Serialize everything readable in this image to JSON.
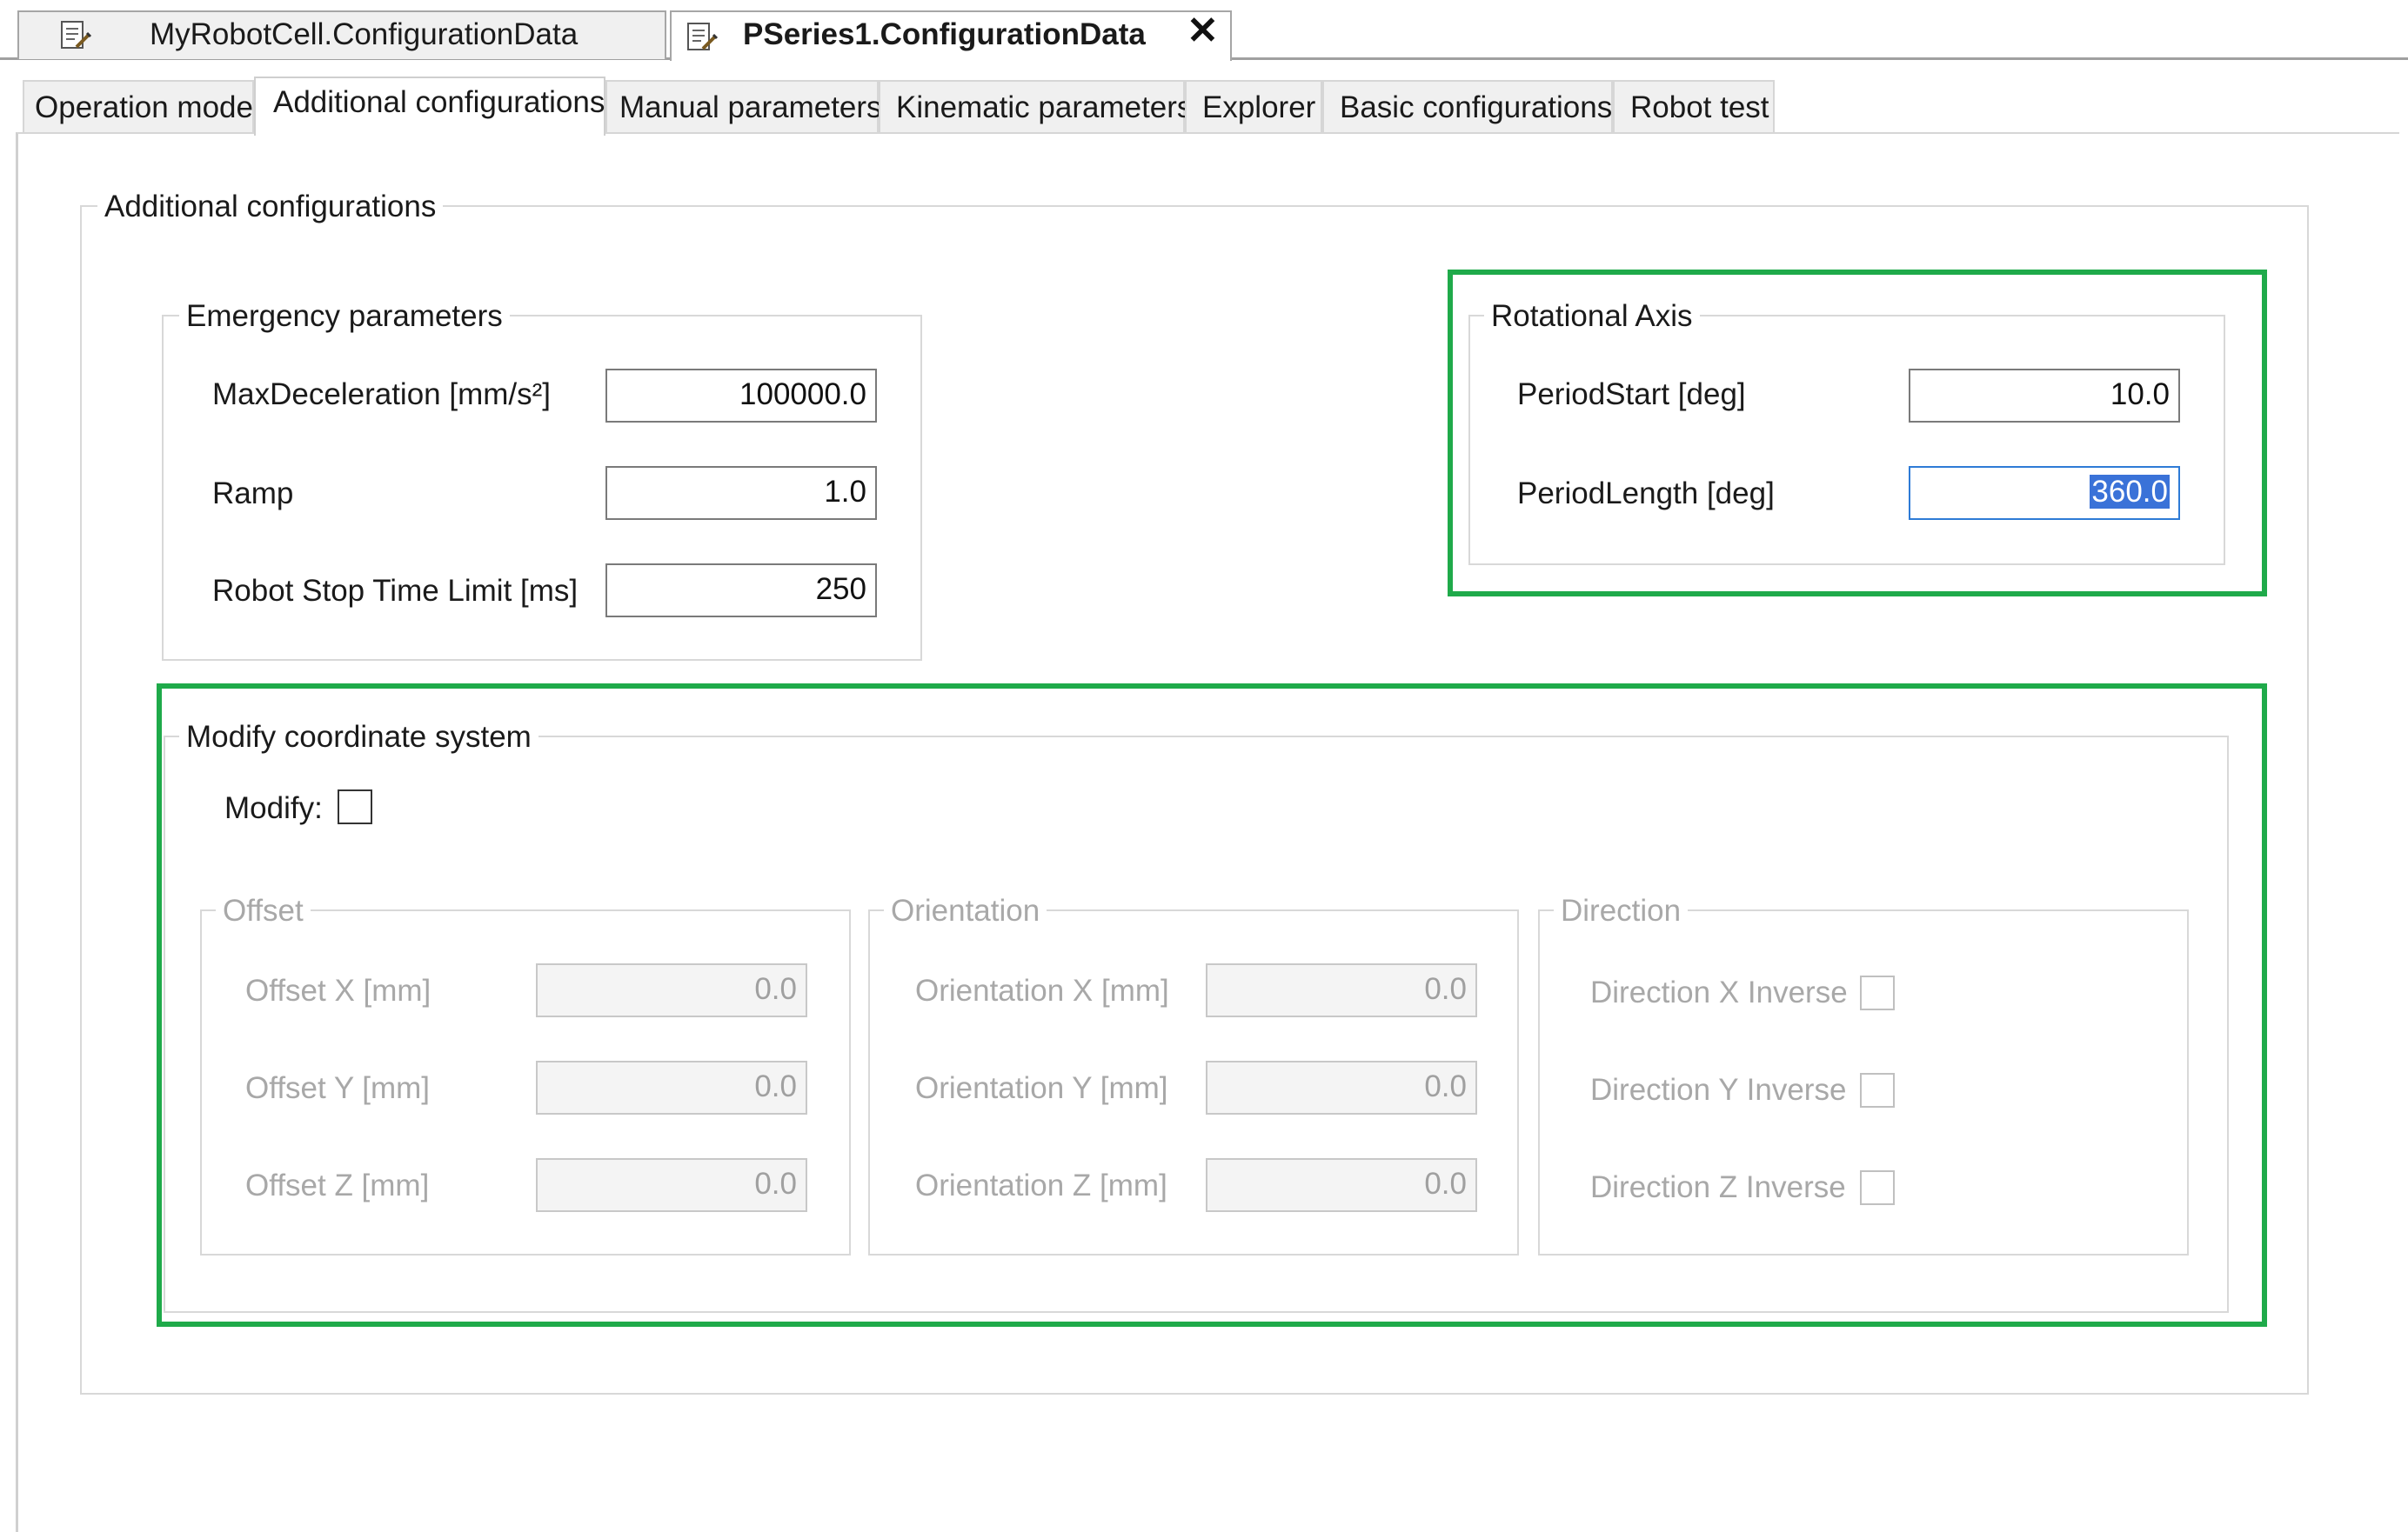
{
  "doc_tabs": [
    {
      "label": "MyRobotCell.ConfigurationData",
      "active": false
    },
    {
      "label": "PSeries1.ConfigurationData",
      "active": true,
      "close_glyph": "✕"
    }
  ],
  "tabs": [
    {
      "label": "Operation mode"
    },
    {
      "label": "Additional configurations"
    },
    {
      "label": "Manual parameters"
    },
    {
      "label": "Kinematic parameters"
    },
    {
      "label": "Explorer"
    },
    {
      "label": "Basic configurations"
    },
    {
      "label": "Robot test"
    }
  ],
  "main_group": {
    "title": "Additional configurations"
  },
  "emergency": {
    "title": "Emergency parameters",
    "fields": [
      {
        "label": "MaxDeceleration [mm/s²]",
        "value": "100000.0"
      },
      {
        "label": "Ramp",
        "value": "1.0"
      },
      {
        "label": "Robot Stop Time Limit [ms]",
        "value": "250"
      }
    ]
  },
  "rotational": {
    "title": "Rotational Axis",
    "fields": [
      {
        "label": "PeriodStart [deg]",
        "value": "10.0"
      },
      {
        "label": "PeriodLength [deg]",
        "value": "360.0"
      }
    ]
  },
  "coordinate": {
    "title": "Modify coordinate system",
    "modify_label": "Modify:",
    "modify_checked": false,
    "offset": {
      "title": "Offset",
      "fields": [
        {
          "label": "Offset X [mm]",
          "value": "0.0"
        },
        {
          "label": "Offset Y [mm]",
          "value": "0.0"
        },
        {
          "label": "Offset Z [mm]",
          "value": "0.0"
        }
      ]
    },
    "orientation": {
      "title": "Orientation",
      "fields": [
        {
          "label": "Orientation X [mm]",
          "value": "0.0"
        },
        {
          "label": "Orientation Y [mm]",
          "value": "0.0"
        },
        {
          "label": "Orientation Z [mm]",
          "value": "0.0"
        }
      ]
    },
    "direction": {
      "title": "Direction",
      "fields": [
        {
          "label": "Direction X Inverse",
          "checked": false
        },
        {
          "label": "Direction Y Inverse",
          "checked": false
        },
        {
          "label": "Direction Z Inverse",
          "checked": false
        }
      ]
    }
  },
  "colors": {
    "highlight": "#1faa4a",
    "selection": "#3a72d8",
    "disabled_text": "#a8a8a8"
  }
}
